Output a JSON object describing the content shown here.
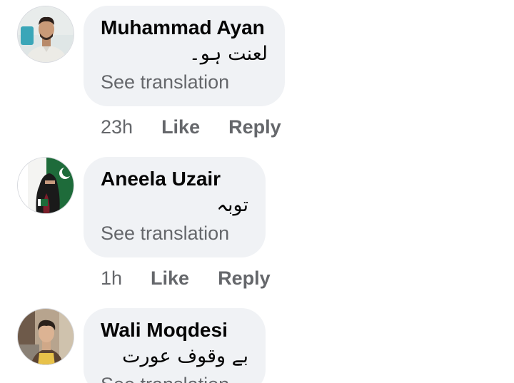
{
  "comments": [
    {
      "author": "Muhammad Ayan",
      "text": "لعنت ہو۔",
      "see_translation": "See translation",
      "time": "23h",
      "like": "Like",
      "reply": "Reply"
    },
    {
      "author": "Aneela Uzair",
      "text": "توبہ",
      "see_translation": "See translation",
      "time": "1h",
      "like": "Like",
      "reply": "Reply"
    },
    {
      "author": "Wali Moqdesi",
      "text": "بے وقوف عورت",
      "see_translation": "See translation"
    }
  ],
  "colors": {
    "bubble": "#f0f2f5",
    "primary_text": "#050505",
    "secondary_text": "#65676b"
  }
}
